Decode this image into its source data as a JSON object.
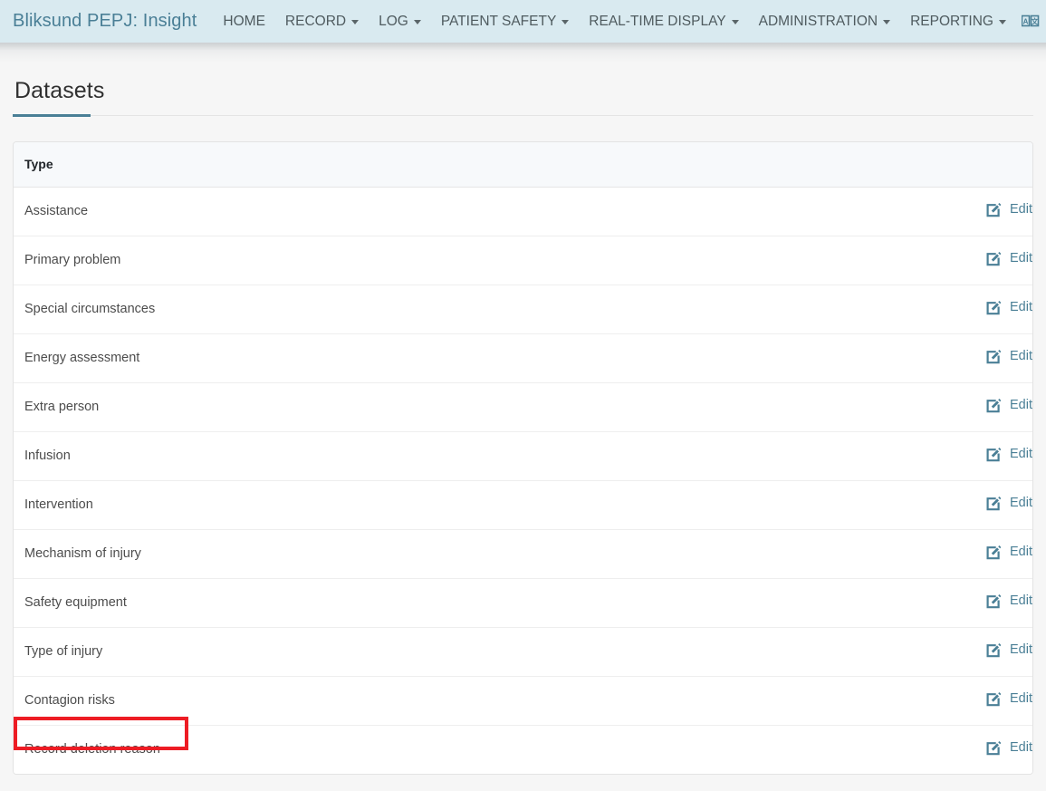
{
  "navbar": {
    "brand": "Bliksund PEPJ: Insight",
    "items": [
      {
        "label": "HOME",
        "has_caret": false
      },
      {
        "label": "RECORD",
        "has_caret": true
      },
      {
        "label": "LOG",
        "has_caret": true
      },
      {
        "label": "PATIENT SAFETY",
        "has_caret": true
      },
      {
        "label": "REAL-TIME DISPLAY",
        "has_caret": true
      },
      {
        "label": "ADMINISTRATION",
        "has_caret": true
      },
      {
        "label": "REPORTING",
        "has_caret": true
      }
    ],
    "icons": [
      {
        "name": "language-translate-icon"
      },
      {
        "name": "logout-icon"
      }
    ],
    "background_color": "#d9eaf0",
    "brand_color": "#4a7f96",
    "link_color": "#4f5b5f"
  },
  "page": {
    "title": "Datasets",
    "accent_color": "#4a7f96"
  },
  "table": {
    "columns": [
      "Type",
      ""
    ],
    "edit_label": "Edit",
    "edit_icon": "edit-pencil-square-icon",
    "rows": [
      {
        "type": "Assistance"
      },
      {
        "type": "Primary problem"
      },
      {
        "type": "Special circumstances"
      },
      {
        "type": "Energy assessment"
      },
      {
        "type": "Extra person"
      },
      {
        "type": "Infusion"
      },
      {
        "type": "Intervention"
      },
      {
        "type": "Mechanism of injury"
      },
      {
        "type": "Safety equipment"
      },
      {
        "type": "Type of injury"
      },
      {
        "type": "Contagion risks"
      },
      {
        "type": "Record deletion reason"
      }
    ]
  },
  "annotation": {
    "highlight_target": "Record deletion reason",
    "highlight_color": "#ed1c24"
  }
}
